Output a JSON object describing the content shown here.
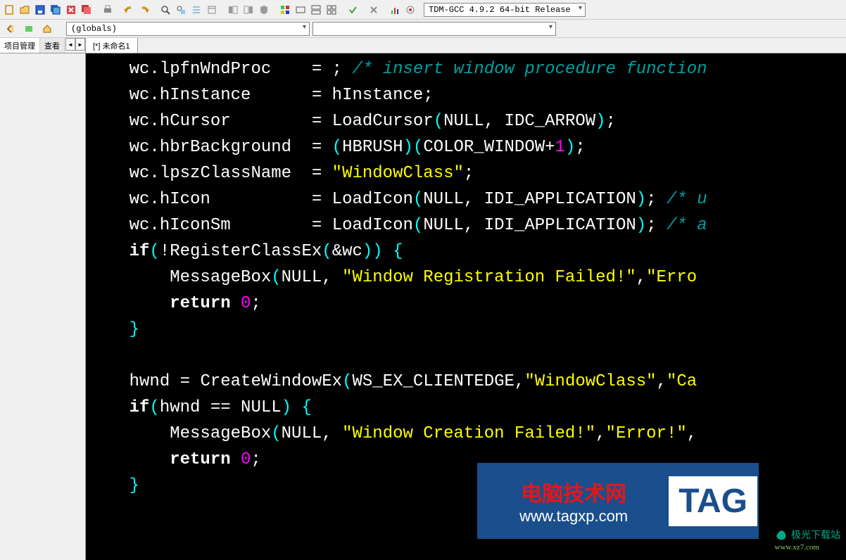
{
  "toolbar": {
    "compiler": "TDM-GCC 4.9.2 64-bit Release"
  },
  "secondbar": {
    "scope": "(globals)"
  },
  "left_tabs": {
    "project": "项目管理",
    "view": "查看"
  },
  "file_tab": "[*] 未命名1",
  "code_lines": [
    {
      "indent": "    ",
      "parts": [
        {
          "t": "wc",
          "c": "ident"
        },
        {
          "t": ".",
          "c": "op"
        },
        {
          "t": "lpfnWndProc",
          "c": "ident"
        },
        {
          "t": "    = ; ",
          "c": "op"
        },
        {
          "t": "/* insert window procedure function",
          "c": "comment"
        }
      ]
    },
    {
      "indent": "    ",
      "parts": [
        {
          "t": "wc",
          "c": "ident"
        },
        {
          "t": ".",
          "c": "op"
        },
        {
          "t": "hInstance",
          "c": "ident"
        },
        {
          "t": "      = ",
          "c": "op"
        },
        {
          "t": "hInstance",
          "c": "ident"
        },
        {
          "t": ";",
          "c": "op"
        }
      ]
    },
    {
      "indent": "    ",
      "parts": [
        {
          "t": "wc",
          "c": "ident"
        },
        {
          "t": ".",
          "c": "op"
        },
        {
          "t": "hCursor",
          "c": "ident"
        },
        {
          "t": "        = ",
          "c": "op"
        },
        {
          "t": "LoadCursor",
          "c": "ident"
        },
        {
          "t": "(",
          "c": "paren"
        },
        {
          "t": "NULL",
          "c": "ident"
        },
        {
          "t": ", ",
          "c": "op"
        },
        {
          "t": "IDC_ARROW",
          "c": "ident"
        },
        {
          "t": ")",
          "c": "paren"
        },
        {
          "t": ";",
          "c": "op"
        }
      ]
    },
    {
      "indent": "    ",
      "parts": [
        {
          "t": "wc",
          "c": "ident"
        },
        {
          "t": ".",
          "c": "op"
        },
        {
          "t": "hbrBackground",
          "c": "ident"
        },
        {
          "t": "  = ",
          "c": "op"
        },
        {
          "t": "(",
          "c": "paren"
        },
        {
          "t": "HBRUSH",
          "c": "ident"
        },
        {
          "t": ")(",
          "c": "paren"
        },
        {
          "t": "COLOR_WINDOW",
          "c": "ident"
        },
        {
          "t": "+",
          "c": "op"
        },
        {
          "t": "1",
          "c": "num"
        },
        {
          "t": ")",
          "c": "paren"
        },
        {
          "t": ";",
          "c": "op"
        }
      ]
    },
    {
      "indent": "    ",
      "parts": [
        {
          "t": "wc",
          "c": "ident"
        },
        {
          "t": ".",
          "c": "op"
        },
        {
          "t": "lpszClassName",
          "c": "ident"
        },
        {
          "t": "  = ",
          "c": "op"
        },
        {
          "t": "\"WindowClass\"",
          "c": "str"
        },
        {
          "t": ";",
          "c": "op"
        }
      ]
    },
    {
      "indent": "    ",
      "parts": [
        {
          "t": "wc",
          "c": "ident"
        },
        {
          "t": ".",
          "c": "op"
        },
        {
          "t": "hIcon",
          "c": "ident"
        },
        {
          "t": "          = ",
          "c": "op"
        },
        {
          "t": "LoadIcon",
          "c": "ident"
        },
        {
          "t": "(",
          "c": "paren"
        },
        {
          "t": "NULL",
          "c": "ident"
        },
        {
          "t": ", ",
          "c": "op"
        },
        {
          "t": "IDI_APPLICATION",
          "c": "ident"
        },
        {
          "t": ")",
          "c": "paren"
        },
        {
          "t": "; ",
          "c": "op"
        },
        {
          "t": "/* u",
          "c": "comment"
        }
      ]
    },
    {
      "indent": "    ",
      "parts": [
        {
          "t": "wc",
          "c": "ident"
        },
        {
          "t": ".",
          "c": "op"
        },
        {
          "t": "hIconSm",
          "c": "ident"
        },
        {
          "t": "        = ",
          "c": "op"
        },
        {
          "t": "LoadIcon",
          "c": "ident"
        },
        {
          "t": "(",
          "c": "paren"
        },
        {
          "t": "NULL",
          "c": "ident"
        },
        {
          "t": ", ",
          "c": "op"
        },
        {
          "t": "IDI_APPLICATION",
          "c": "ident"
        },
        {
          "t": ")",
          "c": "paren"
        },
        {
          "t": "; ",
          "c": "op"
        },
        {
          "t": "/* a",
          "c": "comment"
        }
      ]
    },
    {
      "indent": "",
      "parts": []
    },
    {
      "indent": "    ",
      "parts": [
        {
          "t": "if",
          "c": "kw"
        },
        {
          "t": "(",
          "c": "paren"
        },
        {
          "t": "!",
          "c": "op"
        },
        {
          "t": "RegisterClassEx",
          "c": "ident"
        },
        {
          "t": "(",
          "c": "paren"
        },
        {
          "t": "&",
          "c": "op"
        },
        {
          "t": "wc",
          "c": "ident"
        },
        {
          "t": "))",
          "c": "paren"
        },
        {
          "t": " ",
          "c": "op"
        },
        {
          "t": "{",
          "c": "paren"
        }
      ]
    },
    {
      "indent": "        ",
      "parts": [
        {
          "t": "MessageBox",
          "c": "ident"
        },
        {
          "t": "(",
          "c": "paren"
        },
        {
          "t": "NULL",
          "c": "ident"
        },
        {
          "t": ", ",
          "c": "op"
        },
        {
          "t": "\"Window Registration Failed!\"",
          "c": "str"
        },
        {
          "t": ",",
          "c": "op"
        },
        {
          "t": "\"Erro",
          "c": "str"
        }
      ]
    },
    {
      "indent": "        ",
      "parts": [
        {
          "t": "return",
          "c": "kw"
        },
        {
          "t": " ",
          "c": "op"
        },
        {
          "t": "0",
          "c": "num"
        },
        {
          "t": ";",
          "c": "op"
        }
      ]
    },
    {
      "indent": "    ",
      "parts": [
        {
          "t": "}",
          "c": "paren"
        }
      ]
    },
    {
      "highlight": true,
      "indent": "",
      "parts": []
    },
    {
      "indent": "    ",
      "parts": [
        {
          "t": "hwnd",
          "c": "ident"
        },
        {
          "t": " = ",
          "c": "op"
        },
        {
          "t": "CreateWindowEx",
          "c": "ident"
        },
        {
          "t": "(",
          "c": "paren"
        },
        {
          "t": "WS_EX_CLIENTEDGE",
          "c": "ident"
        },
        {
          "t": ",",
          "c": "op"
        },
        {
          "t": "\"WindowClass\"",
          "c": "str"
        },
        {
          "t": ",",
          "c": "op"
        },
        {
          "t": "\"Ca",
          "c": "str"
        }
      ]
    },
    {
      "indent": "    ",
      "parts": [
        {
          "t": "if",
          "c": "kw"
        },
        {
          "t": "(",
          "c": "paren"
        },
        {
          "t": "hwnd",
          "c": "ident"
        },
        {
          "t": " == ",
          "c": "op"
        },
        {
          "t": "NULL",
          "c": "ident"
        },
        {
          "t": ")",
          "c": "paren"
        },
        {
          "t": " ",
          "c": "op"
        },
        {
          "t": "{",
          "c": "paren"
        }
      ]
    },
    {
      "indent": "        ",
      "parts": [
        {
          "t": "MessageBox",
          "c": "ident"
        },
        {
          "t": "(",
          "c": "paren"
        },
        {
          "t": "NULL",
          "c": "ident"
        },
        {
          "t": ", ",
          "c": "op"
        },
        {
          "t": "\"Window Creation Failed!\"",
          "c": "str"
        },
        {
          "t": ",",
          "c": "op"
        },
        {
          "t": "\"Error!\"",
          "c": "str"
        },
        {
          "t": ",",
          "c": "op"
        }
      ]
    },
    {
      "indent": "        ",
      "parts": [
        {
          "t": "return",
          "c": "kw"
        },
        {
          "t": " ",
          "c": "op"
        },
        {
          "t": "0",
          "c": "num"
        },
        {
          "t": ";",
          "c": "op"
        }
      ]
    },
    {
      "indent": "    ",
      "parts": [
        {
          "t": "}",
          "c": "paren"
        }
      ]
    },
    {
      "indent": "",
      "parts": []
    }
  ],
  "watermark": {
    "title": "电脑技术网",
    "url": "www.tagxp.com",
    "tag": "TAG"
  },
  "brand": {
    "name": "极光下载站",
    "url": "www.xz7.com"
  },
  "icons": {
    "new": "□",
    "open": "📂",
    "save": "💾",
    "saveall": "🗃",
    "close": "✖",
    "closeall": "⊗",
    "print": "🖨",
    "undo": "↶",
    "redo": "↷",
    "find": "🔍",
    "replace": "🔎",
    "goto": "≡",
    "bookmark": "▤",
    "dbg1": "◧",
    "dbg2": "◨",
    "dbg3": "◈",
    "grid1": "⊞",
    "grid2": "▭",
    "grid3": "⊟",
    "grid4": "⊡",
    "check": "✔",
    "stop": "✖",
    "chart": "📊",
    "cog": "⚙",
    "back": "↩",
    "fwd": "↪",
    "home": "▣"
  }
}
